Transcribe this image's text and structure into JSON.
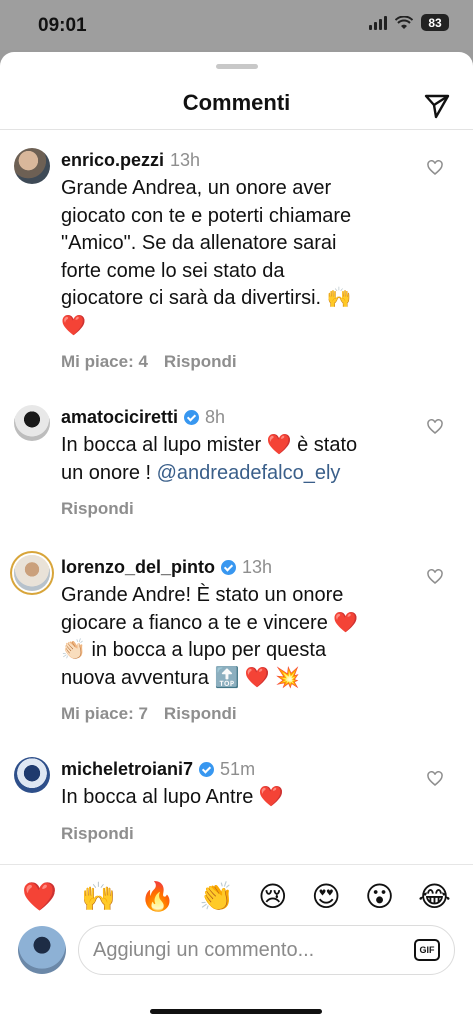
{
  "status_bar": {
    "time": "09:01",
    "battery": "83"
  },
  "sheet": {
    "title": "Commenti"
  },
  "comments": [
    {
      "username": "enrico.pezzi",
      "verified": false,
      "time": "13h",
      "text": "Grande Andrea, un onore aver\ngiocato con te e poterti chiamare\n\"Amico\". Se da allenatore sarai\nforte come lo sei stato da\ngiocatore ci sarà da divertirsi. 🙌\n❤️",
      "likes_label": "Mi piace: 4",
      "reply_label": "Rispondi"
    },
    {
      "username": "amatociciretti",
      "verified": true,
      "time": "8h",
      "text": "In bocca al lupo mister ❤️ è stato\nun onore ! ",
      "mention": "@andreadefalco_ely",
      "reply_label": "Rispondi"
    },
    {
      "username": "lorenzo_del_pinto",
      "verified": true,
      "time": "13h",
      "text": "Grande Andre! È stato un onore\ngiocare a fianco a te e vincere ❤️\n👏🏻 in bocca a lupo per questa\nnuova avventura 🔝 ❤️ 💥",
      "likes_label": "Mi piace: 7",
      "reply_label": "Rispondi"
    },
    {
      "username": "micheletroiani7",
      "verified": true,
      "time": "51m",
      "text": "In bocca al lupo Antre ❤️",
      "reply_label": "Rispondi"
    }
  ],
  "emoji_bar": [
    "❤️",
    "🙌",
    "🔥",
    "👏",
    "😢",
    "😍",
    "😮",
    "😂"
  ],
  "composer": {
    "placeholder": "Aggiungi un commento...",
    "gif_label": "GIF"
  },
  "icons": {
    "send": "send-icon",
    "like": "heart-outline-icon"
  }
}
